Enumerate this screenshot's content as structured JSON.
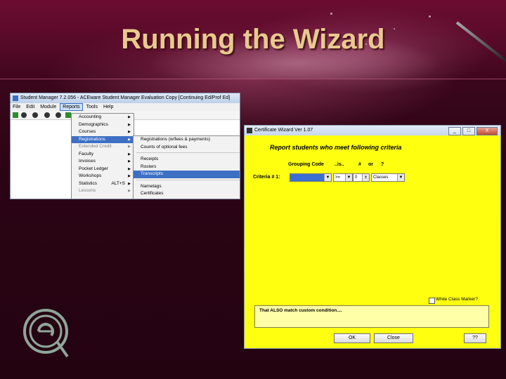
{
  "slide": {
    "title": "Running the Wizard"
  },
  "student_manager": {
    "title": "Student Manager 7.2.056 - ACEware Student Manager Evaluation Copy [Continuing Ed/Prof Ed]",
    "menubar": [
      "File",
      "Edit",
      "Module",
      "Reports",
      "Tools",
      "Help"
    ],
    "reports_menu": [
      {
        "label": "Accounting",
        "submenu": true
      },
      {
        "label": "Demographics",
        "submenu": true
      },
      {
        "label": "Courses",
        "submenu": true
      },
      {
        "label": "Registrations",
        "submenu": true,
        "highlighted": true
      },
      {
        "label": "Extended Credit",
        "submenu": true,
        "disabled": true
      },
      {
        "label": "Faculty",
        "submenu": true
      },
      {
        "label": "Invoices",
        "submenu": true
      },
      {
        "label": "Pocket Ledger",
        "submenu": true
      },
      {
        "label": "Workshops",
        "submenu": true
      },
      {
        "label": "Statistics",
        "shortcut": "ALT+S",
        "submenu": true
      },
      {
        "label": "Lessons",
        "submenu": true,
        "disabled": true
      }
    ],
    "registrations_submenu": [
      {
        "label": "Registrations (w/fees & payments)"
      },
      {
        "label": "Counts of optional fees"
      },
      {
        "separator": true
      },
      {
        "label": "Receipts"
      },
      {
        "label": "Rosters",
        "submenu": true
      },
      {
        "label": "Transcripts",
        "highlighted": true
      },
      {
        "separator": true
      },
      {
        "label": "Nametags"
      },
      {
        "label": "Certificates"
      }
    ]
  },
  "wizard": {
    "title": "Certificate Wizard Ver 1.07",
    "window_buttons": [
      "_",
      "□",
      "X"
    ],
    "heading": "Report students who meet following criteria",
    "column_headers": [
      "Grouping Code",
      "..is..",
      "#",
      "or",
      "?"
    ],
    "criteria_label": "Criteria # 1:",
    "grouping_code_value": "",
    "operator_value": ">=",
    "number_value": "0",
    "units_value": "Classes",
    "checkbox_label": "While Class Marker?",
    "condition_text": "That ALSO match custom condition....",
    "ok_label": "OK",
    "close_label": "Close",
    "help_label": "??"
  },
  "colors": {
    "wizard_bg": "#ffff10",
    "title": "#e9c98f",
    "highlight": "#3d6fc4"
  }
}
